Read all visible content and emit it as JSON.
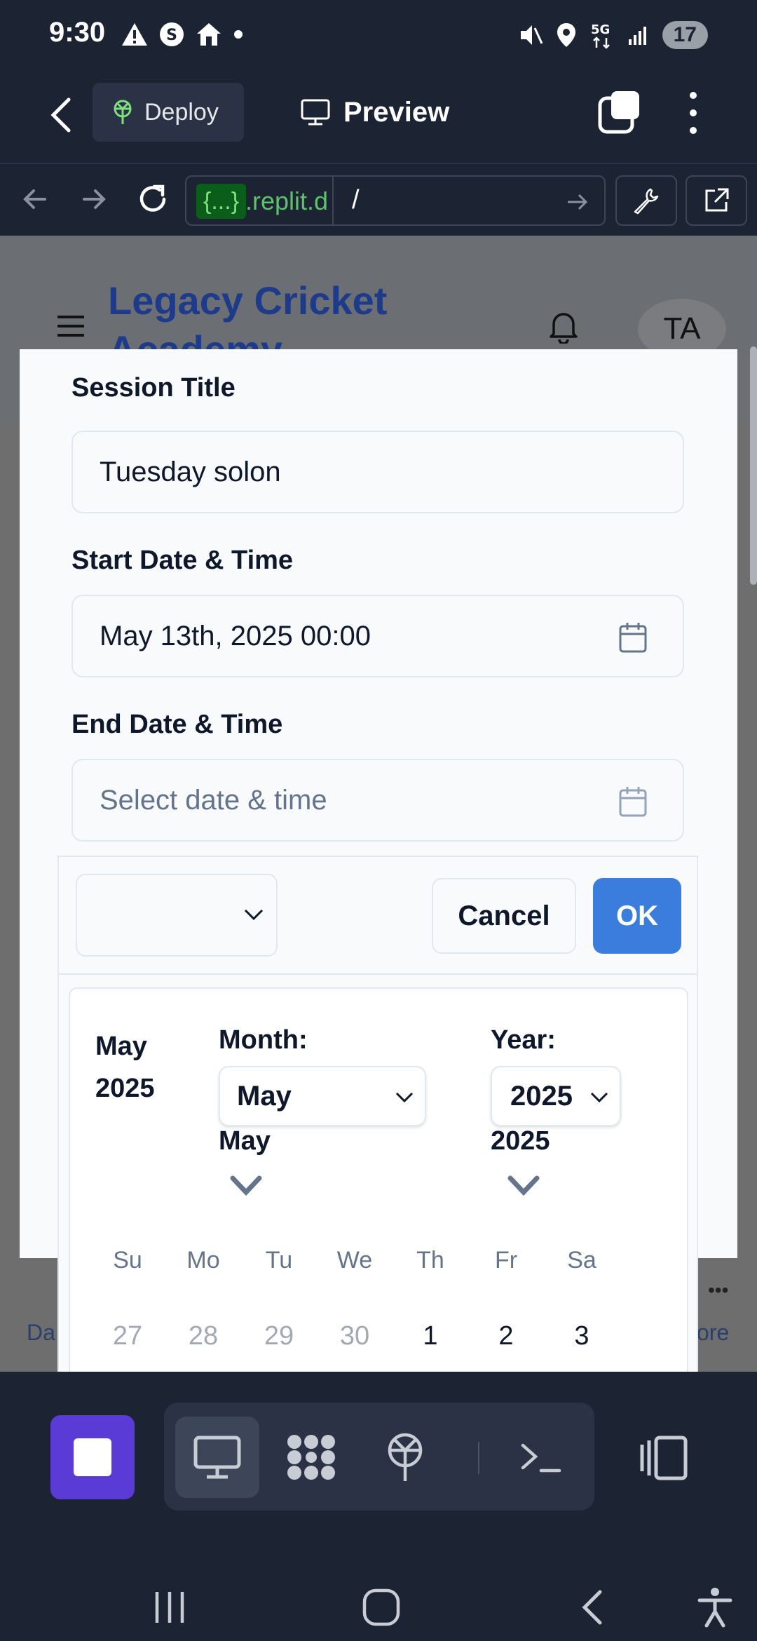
{
  "status_bar": {
    "time": "9:30",
    "left_icons": [
      "warning-icon",
      "s-app-icon",
      "home-icon",
      "dot-icon"
    ],
    "right_icons": [
      "mute-icon",
      "location-icon",
      "5g-icon",
      "signal-icon"
    ],
    "battery": "17"
  },
  "app_toolbar": {
    "deploy_label": "Deploy",
    "preview_label": "Preview"
  },
  "url_bar": {
    "host_badge": "{...}",
    "host_rest": ".replit.dev",
    "path": "/"
  },
  "site": {
    "title": "Legacy Cricket Academy",
    "avatar_initials": "TA",
    "behind_left": "Da",
    "behind_right": "ore",
    "behind_dots": "•••"
  },
  "dialog": {
    "session_title_label": "Session Title",
    "session_title_value": "Tuesday solon",
    "start_label": "Start Date & Time",
    "start_value": "May 13th, 2025 00:00",
    "end_label": "End Date & Time",
    "end_placeholder": "Select date & time"
  },
  "picker": {
    "cancel_label": "Cancel",
    "ok_label": "OK",
    "caption_month": "May",
    "caption_year": "2025",
    "month_label": "Month:",
    "month_value": "May",
    "month_dup": "May",
    "year_label": "Year:",
    "year_value": "2025",
    "year_dup": "2025",
    "weekdays": [
      "Su",
      "Mo",
      "Tu",
      "We",
      "Th",
      "Fr",
      "Sa"
    ],
    "first_week": [
      {
        "day": "27",
        "outside": true
      },
      {
        "day": "28",
        "outside": true
      },
      {
        "day": "29",
        "outside": true
      },
      {
        "day": "30",
        "outside": true
      },
      {
        "day": "1",
        "outside": false
      },
      {
        "day": "2",
        "outside": false
      },
      {
        "day": "3",
        "outside": false
      }
    ]
  },
  "colors": {
    "chrome_bg": "#1c2333",
    "ok_button": "#3b7ddd",
    "stop_button": "#5b3bd6",
    "url_green": "#5ec26a"
  }
}
